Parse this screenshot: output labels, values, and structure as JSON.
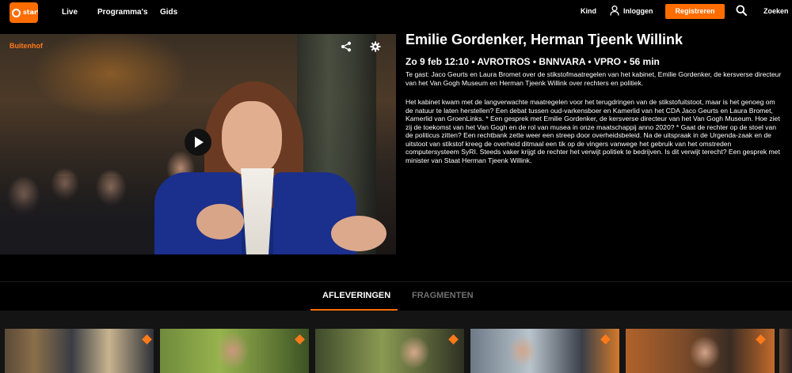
{
  "header": {
    "logo_text": "start",
    "nav": [
      "Live",
      "Programma's",
      "Gids"
    ],
    "kind_label": "Kind",
    "login_label": "Inloggen",
    "register_label": "Registreren",
    "search_label": "Zoeken"
  },
  "player": {
    "program_label": "Buitenhof"
  },
  "episode": {
    "title": "Emilie Gordenker, Herman Tjeenk Willink",
    "meta": "Zo 9 feb 12:10 • AVROTROS • BNNVARA • VPRO • 56 min",
    "description_1": "Te gast: Jaco Geurts en Laura Bromet over de stikstofmaatregelen van het kabinet, Emilie Gordenker, de kersverse directeur van het Van Gogh Museum en Herman Tjeenk Willink over rechters en politiek.",
    "description_2": "Het kabinet kwam met de langverwachte maatregelen voor het terugdringen van de stikstofuitstoot, maar is het genoeg om de natuur te laten herstellen? Een debat tussen oud-varkensboer en Kamerlid van het CDA Jaco Geurts en Laura Bromet, Kamerlid van GroenLinks. * Een gesprek met Emilie Gordenker, de kersverse directeur van het Van Gogh Museum. Hoe ziet zij de toekomst van het Van Gogh en de rol van musea in onze maatschappij anno 2020? * Gaat de rechter op de stoel van de politicus zitten? Een rechtbank zette weer een streep door overheidsbeleid. Na de uitspraak in de Urgenda-zaak en de uitstoot van stikstof kreeg de overheid ditmaal een tik op de vingers vanwege het gebruik van het omstreden computersysteem SyRI. Steeds vaker krijgt de rechter het verwijt politiek te bedrijven. Is dit verwijt terecht? Een gesprek met minister van Staat Herman Tjeenk Willink."
  },
  "tabs": {
    "active": "AFLEVERINGEN",
    "inactive": "FRAGMENTEN"
  },
  "colors": {
    "accent": "#ff6d00",
    "background": "#000000",
    "tab_inactive": "#6f6f6f"
  },
  "icons": [
    "user-icon",
    "search-icon",
    "share-icon",
    "settings-icon",
    "play-icon"
  ]
}
